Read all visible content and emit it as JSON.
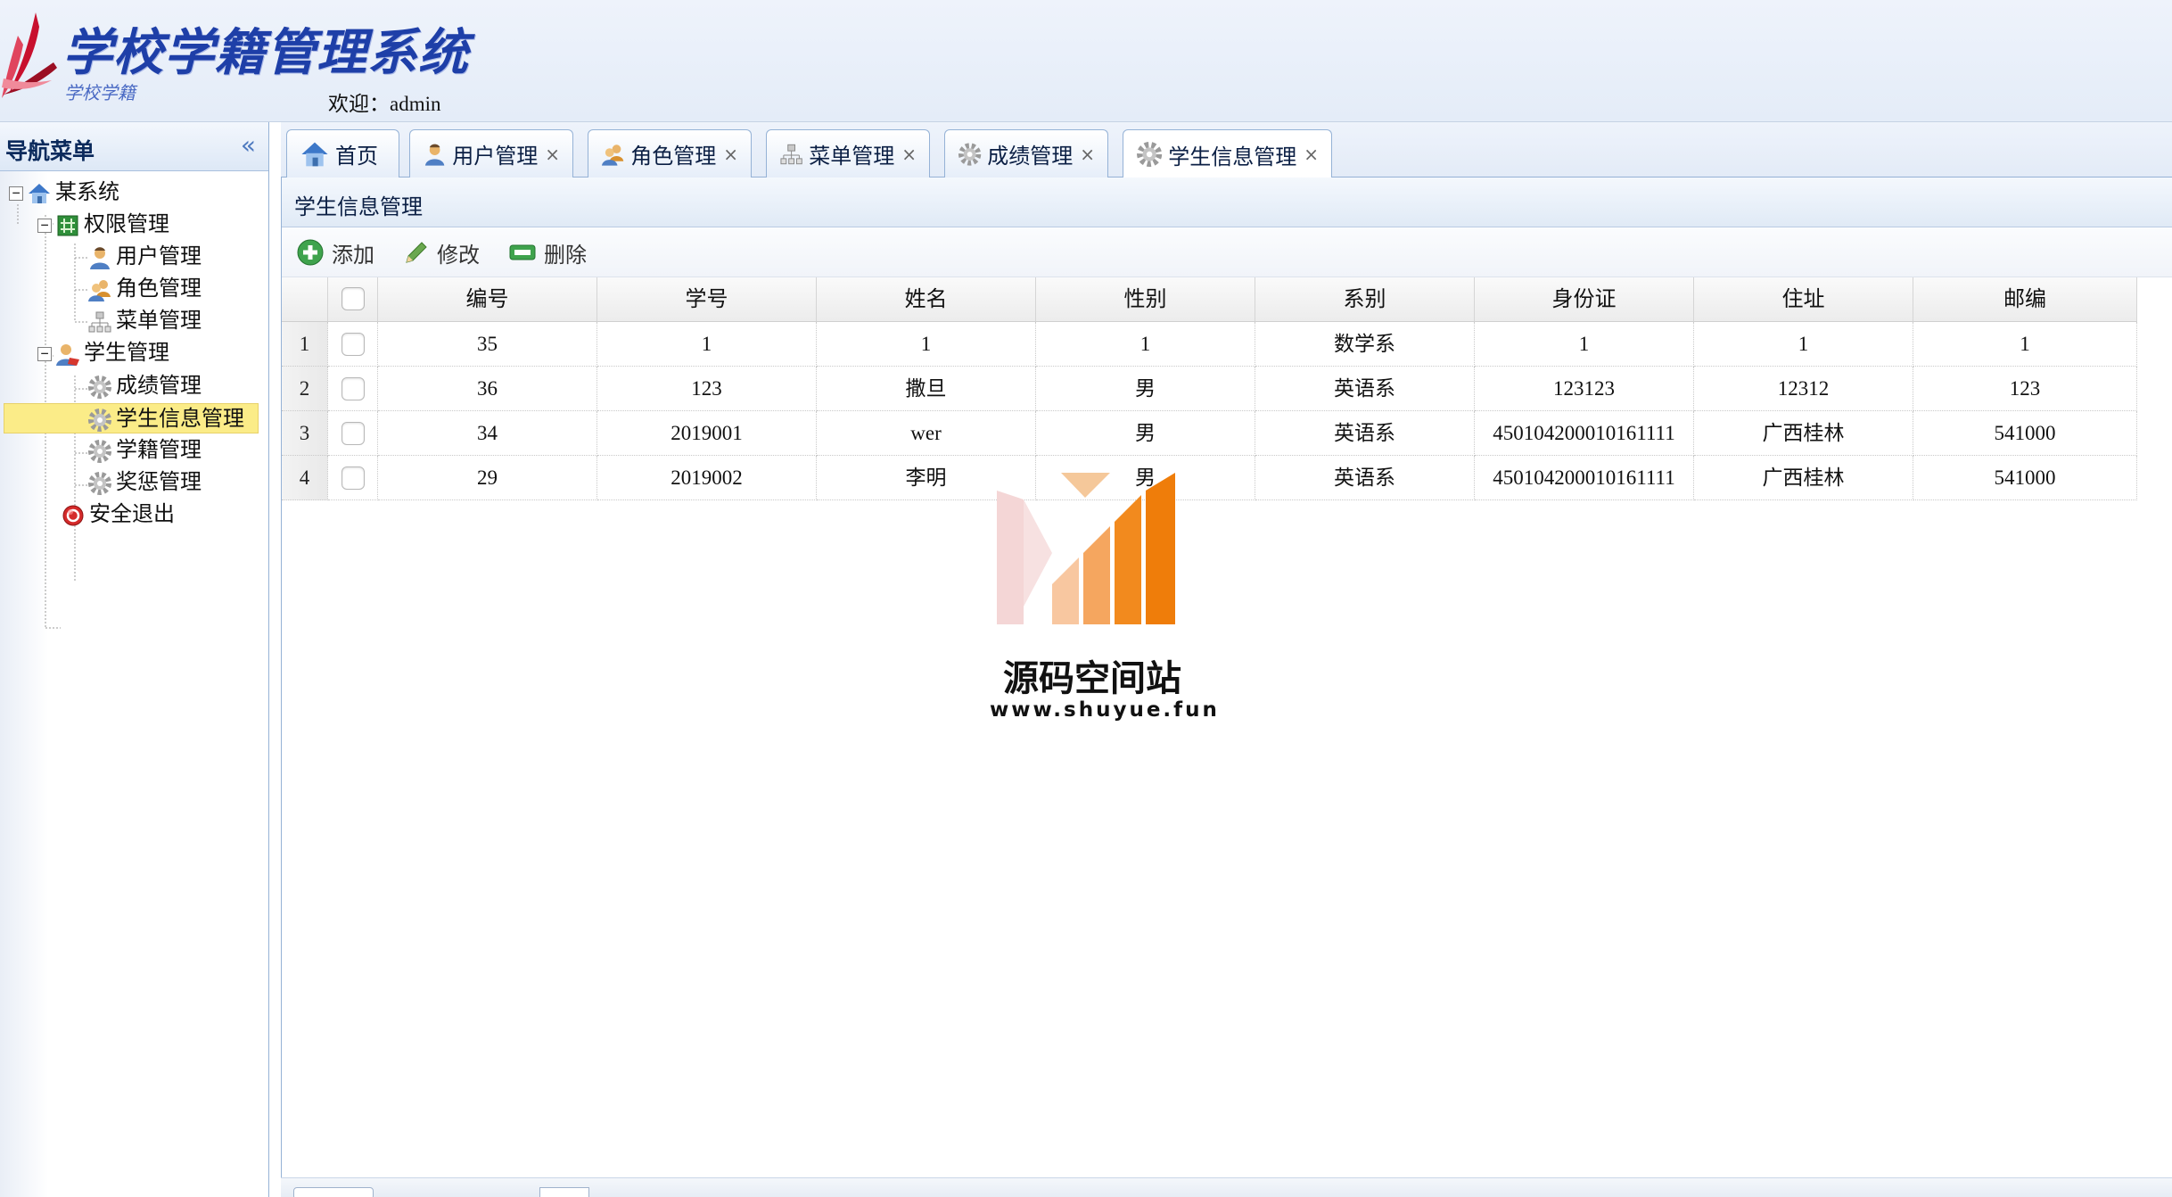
{
  "app": {
    "title": "学校学籍管理系统",
    "subtitle": "学校学籍",
    "welcome": "欢迎：admin",
    "accent": "#1e3fa8"
  },
  "nav": {
    "title": "导航菜单",
    "tree": [
      {
        "label": "某系统",
        "icon": "home-icon"
      },
      {
        "label": "权限管理",
        "icon": "grid-icon"
      },
      {
        "label": "用户管理",
        "icon": "user-icon"
      },
      {
        "label": "角色管理",
        "icon": "users-icon"
      },
      {
        "label": "菜单管理",
        "icon": "sitemap-icon"
      },
      {
        "label": "学生管理",
        "icon": "student-icon"
      },
      {
        "label": "成绩管理",
        "icon": "gear-icon"
      },
      {
        "label": "学生信息管理",
        "icon": "gear-icon",
        "selected": true
      },
      {
        "label": "学籍管理",
        "icon": "gear-icon"
      },
      {
        "label": "奖惩管理",
        "icon": "gear-icon"
      },
      {
        "label": "安全退出",
        "icon": "power-icon"
      }
    ]
  },
  "tabs": [
    {
      "label": "首页",
      "icon": "home-icon",
      "closable": false
    },
    {
      "label": "用户管理",
      "icon": "user-icon",
      "closable": true
    },
    {
      "label": "角色管理",
      "icon": "users-icon",
      "closable": true
    },
    {
      "label": "菜单管理",
      "icon": "sitemap-icon",
      "closable": true
    },
    {
      "label": "成绩管理",
      "icon": "gear-icon",
      "closable": true
    },
    {
      "label": "学生信息管理",
      "icon": "gear-icon",
      "closable": true,
      "active": true
    }
  ],
  "close_glyph": "×",
  "panel": {
    "title": "学生信息管理",
    "toolbar": {
      "add": "添加",
      "edit": "修改",
      "delete": "删除"
    }
  },
  "grid": {
    "columns": [
      "编号",
      "学号",
      "姓名",
      "性别",
      "系别",
      "身份证",
      "住址",
      "邮编"
    ],
    "rows": [
      {
        "n": "1",
        "cells": [
          "35",
          "1",
          "1",
          "1",
          "数学系",
          "1",
          "1",
          "1"
        ]
      },
      {
        "n": "2",
        "cells": [
          "36",
          "123",
          "撒旦",
          "男",
          "英语系",
          "123123",
          "12312",
          "123"
        ]
      },
      {
        "n": "3",
        "cells": [
          "34",
          "2019001",
          "wer",
          "男",
          "英语系",
          "450104200010161111",
          "广西桂林",
          "541000"
        ]
      },
      {
        "n": "4",
        "cells": [
          "29",
          "2019002",
          "李明",
          "男",
          "英语系",
          "450104200010161111",
          "广西桂林",
          "541000"
        ]
      }
    ]
  },
  "watermark": {
    "name": "源码空间站",
    "url": "www.shuyue.fun"
  }
}
